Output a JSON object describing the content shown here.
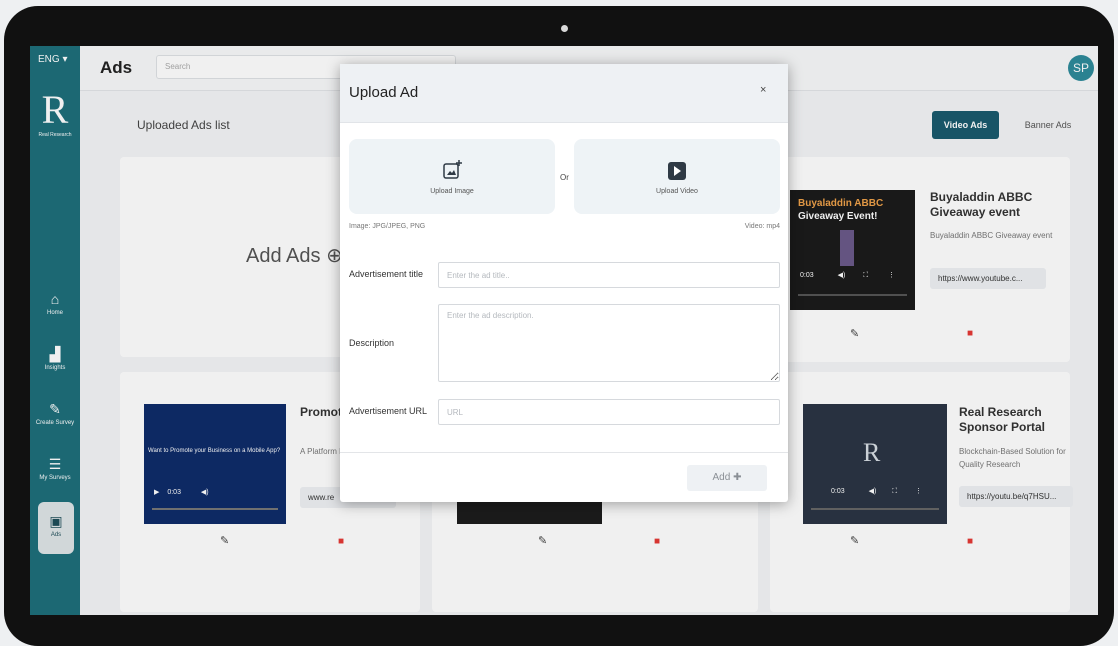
{
  "header": {
    "lang": "ENG",
    "title": "Ads",
    "search_placeholder": "Search",
    "avatar": "SP"
  },
  "logo": {
    "letters": "R",
    "caption": "Real Research"
  },
  "sidebar": {
    "items": [
      {
        "label": "Home",
        "icon": "home-icon"
      },
      {
        "label": "Insights",
        "icon": "insights-icon"
      },
      {
        "label": "Create Survey",
        "icon": "pencil-icon"
      },
      {
        "label": "My Surveys",
        "icon": "list-icon"
      },
      {
        "label": "Ads",
        "icon": "play-icon"
      }
    ]
  },
  "main": {
    "list_title": "Uploaded Ads list",
    "tabs": [
      {
        "label": "Video Ads",
        "active": true
      },
      {
        "label": "Banner Ads",
        "active": false
      }
    ],
    "add_ads_label": "Add Ads"
  },
  "cards": [
    {
      "title": "Buyaladdin ABBC Giveaway event",
      "description": "Buyaladdin ABBC Giveaway event",
      "url": "https://www.youtube.c...",
      "thumb_title": "Buyaladdin ABBC",
      "thumb_sub": "Giveaway Event!",
      "time": "0:03"
    },
    {
      "title": "Promote Real Res",
      "description": "A Platform Niche Tar",
      "url": "www.re",
      "thumb_text": "Want to Promote your Business on a Mobile App?",
      "time": "0:03"
    },
    {
      "title": "Real Research Sponsor Portal",
      "description": "Blockchain-Based Solution for Quality Research",
      "url": "https://youtu.be/q7HSU...",
      "time": "0:03"
    }
  ],
  "modal": {
    "title": "Upload Ad",
    "close": "×",
    "upload_image": "Upload Image",
    "or": "Or",
    "upload_video": "Upload Video",
    "image_hint": "Image: JPG/JPEG, PNG",
    "video_hint": "Video: mp4",
    "title_label": "Advertisement title",
    "title_placeholder": "Enter the ad title..",
    "desc_label": "Description",
    "desc_placeholder": "Enter the ad description.",
    "url_label": "Advertisement URL",
    "url_placeholder": "URL",
    "add_button": "Add"
  },
  "colors": {
    "sidebar": "#1e6f7b",
    "accent": "#1a5b6e",
    "delete": "#e53935"
  }
}
